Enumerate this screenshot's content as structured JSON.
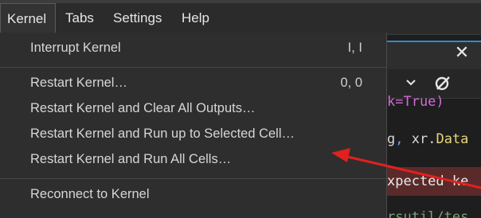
{
  "menubar": {
    "items": [
      {
        "label": "Kernel"
      },
      {
        "label": "Tabs"
      },
      {
        "label": "Settings"
      },
      {
        "label": "Help"
      }
    ]
  },
  "kernel_menu": {
    "items": [
      {
        "label": "Interrupt Kernel",
        "shortcut": "I, I"
      },
      {
        "label": "Restart Kernel…",
        "shortcut": "0, 0"
      },
      {
        "label": "Restart Kernel and Clear All Outputs…",
        "shortcut": ""
      },
      {
        "label": "Restart Kernel and Run up to Selected Cell…",
        "shortcut": ""
      },
      {
        "label": "Restart Kernel and Run All Cells…",
        "shortcut": ""
      },
      {
        "label": "Reconnect to Kernel",
        "shortcut": ""
      }
    ]
  },
  "notebook": {
    "tab_close": "✕",
    "code": {
      "line1": "k=True)",
      "line2_a": "g",
      "line2_b": ", ",
      "line2_c": "xr",
      "line2_d": ".",
      "line2_e": "Data",
      "line3": "xpected ke",
      "line4": "rsutil/tes"
    }
  },
  "colors": {
    "accent": "#2a8dd4",
    "annotation_arrow": "#e0211d"
  },
  "icons": {
    "chevron": "chevron-down-icon",
    "sync": "sync-icon",
    "close": "close-icon"
  }
}
